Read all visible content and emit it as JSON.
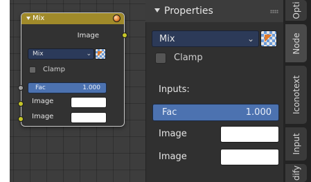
{
  "node": {
    "title": "Mix",
    "output_label": "Image",
    "blend_mode": "Mix",
    "clamp_label": "Clamp",
    "fac_label": "Fac",
    "fac_value": "1.000",
    "input_1_label": "Image",
    "input_2_label": "Image",
    "colors": {
      "header": "#a08a2a",
      "color_socket": "#c7c729",
      "value_socket": "#a1a1a1",
      "field": "#4c72b0"
    }
  },
  "properties": {
    "title": "Properties",
    "blend_mode": "Mix",
    "clamp_label": "Clamp",
    "inputs_label": "Inputs:",
    "fac_label": "Fac",
    "fac_value": "1.000",
    "input_1_label": "Image",
    "input_2_label": "Image"
  },
  "tabs": [
    {
      "label": "Opti"
    },
    {
      "label": "Node"
    },
    {
      "label": "Iconotext"
    },
    {
      "label": "Input"
    },
    {
      "label": "dify"
    }
  ],
  "icons": {
    "collapse": "triangle-down-icon",
    "preview": "sphere-preview-icon",
    "dropdown": "chevron-down-icon",
    "blend_type": "mix-type-icon",
    "grip": "grip-dots-icon"
  }
}
